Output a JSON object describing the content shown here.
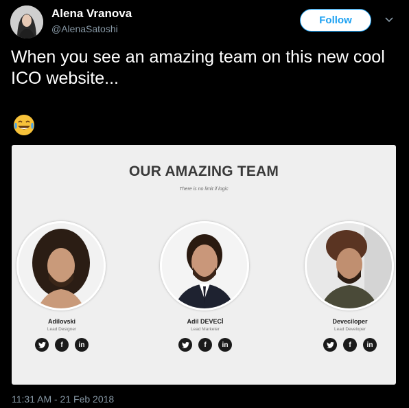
{
  "author": {
    "name": "Alena Vranova",
    "handle": "@AlenaSatoshi",
    "avatar_icon": "profile-photo"
  },
  "follow_button": {
    "label": "Follow",
    "color": "#1da1f2"
  },
  "tweet": {
    "text": "When you see an amazing team on this new cool ICO website...",
    "emoji": "😂",
    "timestamp": "11:31 AM - 21 Feb 2018"
  },
  "media": {
    "title": "OUR AMAZING TEAM",
    "subtitle": "There is no limit if logic",
    "members": [
      {
        "name": "Adilovski",
        "role": "Lead Designer"
      },
      {
        "name": "Adil DEVECİ",
        "role": "Lead Marketer"
      },
      {
        "name": "Deveciloper",
        "role": "Lead Developer"
      }
    ],
    "social_icons": [
      "twitter-icon",
      "facebook-icon",
      "linkedin-icon"
    ]
  },
  "colors": {
    "background": "#000000",
    "secondary_text": "#8899a6",
    "card_background": "#efefef"
  }
}
